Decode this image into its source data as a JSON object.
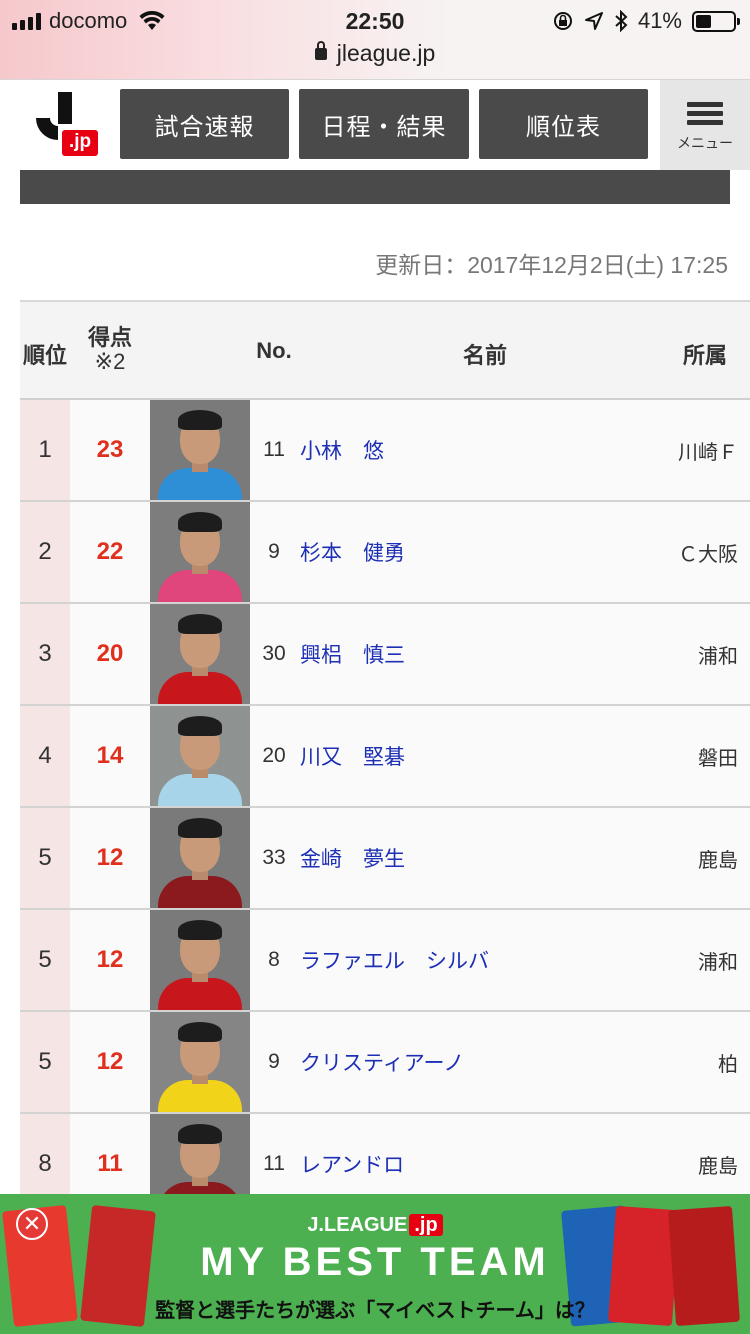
{
  "status_bar": {
    "carrier": "docomo",
    "time": "22:50",
    "battery": "41%",
    "battery_level": 0.41,
    "url": "jleague.jp"
  },
  "header": {
    "logo_text": ".jp",
    "nav": [
      {
        "label": "試合速報"
      },
      {
        "label": "日程・結果"
      },
      {
        "label": "順位表"
      }
    ],
    "menu_label": "メニュー"
  },
  "updated": "更新日：2017年12月2日(土) 17:25",
  "table": {
    "headers": {
      "rank": "順位",
      "points": "得点",
      "points_note": "※2",
      "number": "No.",
      "name": "名前",
      "club": "所属"
    },
    "rows": [
      {
        "rank": "1",
        "points": "23",
        "number": "11",
        "name": "小林　悠",
        "club": "川崎Ｆ",
        "shirt": "#2f8fd6",
        "bg": "#7a7a7a"
      },
      {
        "rank": "2",
        "points": "22",
        "number": "9",
        "name": "杉本　健勇",
        "club": "Ｃ大阪",
        "shirt": "#e0457b",
        "bg": "#7d7d7d"
      },
      {
        "rank": "3",
        "points": "20",
        "number": "30",
        "name": "興梠　慎三",
        "club": "浦和",
        "shirt": "#c8161d",
        "bg": "#808080"
      },
      {
        "rank": "4",
        "points": "14",
        "number": "20",
        "name": "川又　堅碁",
        "club": "磐田",
        "shirt": "#a8d4ea",
        "bg": "#8e9290"
      },
      {
        "rank": "5",
        "points": "12",
        "number": "33",
        "name": "金崎　夢生",
        "club": "鹿島",
        "shirt": "#8b1a1f",
        "bg": "#7a7a7a"
      },
      {
        "rank": "5",
        "points": "12",
        "number": "8",
        "name": "ラファエル　シルバ",
        "club": "浦和",
        "shirt": "#c8161d",
        "bg": "#7a7a7a"
      },
      {
        "rank": "5",
        "points": "12",
        "number": "9",
        "name": "クリスティアーノ",
        "club": "柏",
        "shirt": "#f1d31a",
        "bg": "#858585"
      },
      {
        "rank": "8",
        "points": "11",
        "number": "11",
        "name": "レアンドロ",
        "club": "鹿島",
        "shirt": "#8b1a1f",
        "bg": "#7a7a7a"
      }
    ]
  },
  "banner": {
    "brand": "J.LEAGUE",
    "brand_jp": ".jp",
    "title": "MY BEST TEAM",
    "subtitle": "監督と選手たちが選ぶ「マイベストチーム」は？",
    "close": "✕"
  }
}
